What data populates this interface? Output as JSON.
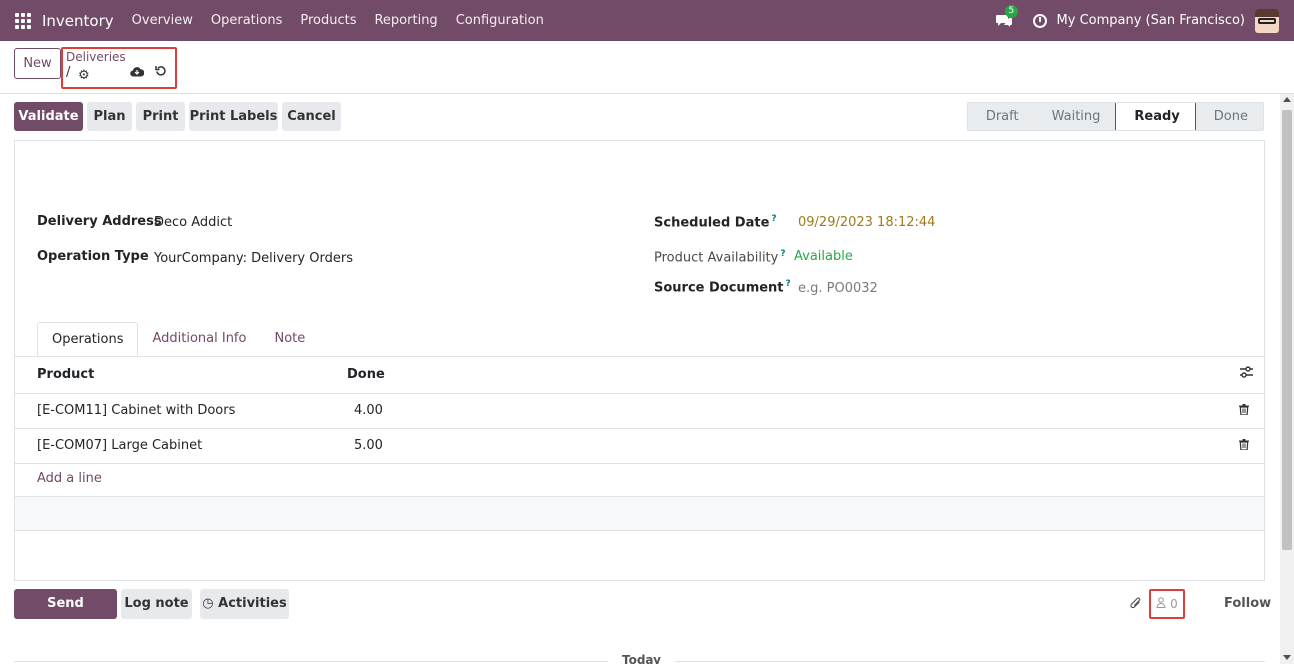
{
  "navbar": {
    "app_name": "Inventory",
    "menu": [
      "Overview",
      "Operations",
      "Products",
      "Reporting",
      "Configuration"
    ],
    "message_count": "5",
    "company": "My Company (San Francisco)"
  },
  "control": {
    "new_label": "New",
    "breadcrumb": "Deliveries",
    "record_name": "/"
  },
  "actions": {
    "validate": "Validate",
    "plan": "Plan",
    "print": "Print",
    "print_labels": "Print Labels",
    "cancel": "Cancel"
  },
  "status": {
    "stages": [
      "Draft",
      "Waiting",
      "Ready",
      "Done"
    ],
    "active": "Ready"
  },
  "form": {
    "delivery_address_label": "Delivery Address",
    "delivery_address": "Deco Addict",
    "operation_type_label": "Operation Type",
    "operation_type": "YourCompany: Delivery Orders",
    "scheduled_date_label": "Scheduled Date",
    "scheduled_date": "09/29/2023 18:12:44",
    "availability_label": "Product Availability",
    "availability": "Available",
    "source_document_label": "Source Document",
    "source_document_placeholder": "e.g. PO0032",
    "help_mark": "?"
  },
  "tabs": [
    "Operations",
    "Additional Info",
    "Note"
  ],
  "table": {
    "headers": [
      "Product",
      "Done"
    ],
    "rows": [
      {
        "product": "[E-COM11] Cabinet with Doors",
        "done": "4.00"
      },
      {
        "product": "[E-COM07] Large Cabinet",
        "done": "5.00"
      }
    ],
    "add_line": "Add a line"
  },
  "chatter": {
    "send_message": "Send message",
    "log_note": "Log note",
    "activities": "Activities",
    "followers_count": "0",
    "follow": "Follow",
    "today": "Today"
  },
  "colors": {
    "brand": "#714b67",
    "success": "#28a745",
    "highlight": "#e03c3c"
  }
}
